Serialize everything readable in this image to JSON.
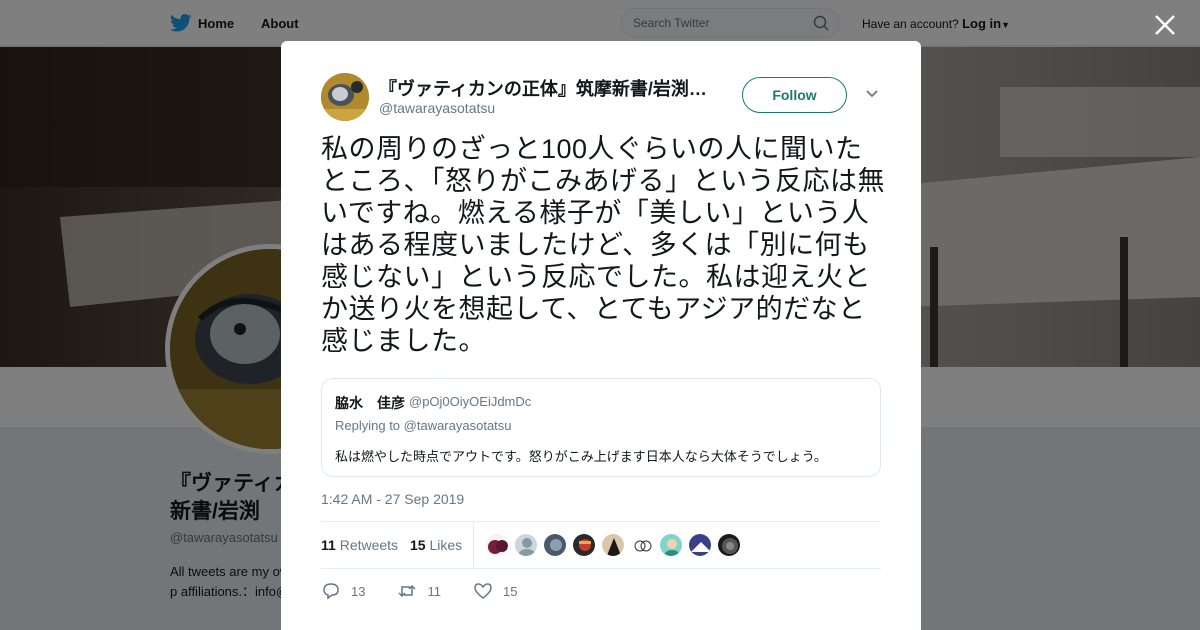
{
  "topbar": {
    "home_label": "Home",
    "about_label": "About",
    "search_placeholder": "Search Twitter",
    "account_question": "Have an account?",
    "login_label": "Log in"
  },
  "profile": {
    "name": "『ヴァティカンの正体』筑摩新書/岩渕",
    "handle": "@tawarayasotatsu",
    "bio": "All tweets are my own and do not represent any of p affiliations.：info@ Junko IWABUCHI"
  },
  "tweet": {
    "author_name": "『ヴァティカンの正体』筑摩新書/岩渕潤子",
    "author_handle": "@tawarayasotatsu",
    "follow_label": "Follow",
    "text": "私の周りのざっと100人ぐらいの人に聞いたところ、「怒りがこみあげる」という反応は無いですね。燃える様子が「美しい」という人はある程度いましたけど、多くは「別に何も感じない」という反応でした。私は迎え火とか送り火を想起して、とてもアジア的だなと感じました。",
    "quote": {
      "name": "脇水　佳彦",
      "handle": "@pOj0OiyOEiJdmDc",
      "replying_to": "Replying to @tawarayasotatsu",
      "text": "私は燃やした時点でアウトです。怒りがこみ上げます日本人なら大体そうでしょう。"
    },
    "timestamp": "1:42 AM - 27 Sep 2019",
    "retweets_count": "11",
    "retweets_label": "Retweets",
    "likes_count": "15",
    "likes_label": "Likes",
    "actions": {
      "reply_count": "13",
      "retweet_count": "11",
      "like_count": "15"
    }
  },
  "colors": {
    "follow_accent": "#1b7a6e",
    "twitter_blue": "#1da1f2",
    "muted_text": "#657786"
  }
}
